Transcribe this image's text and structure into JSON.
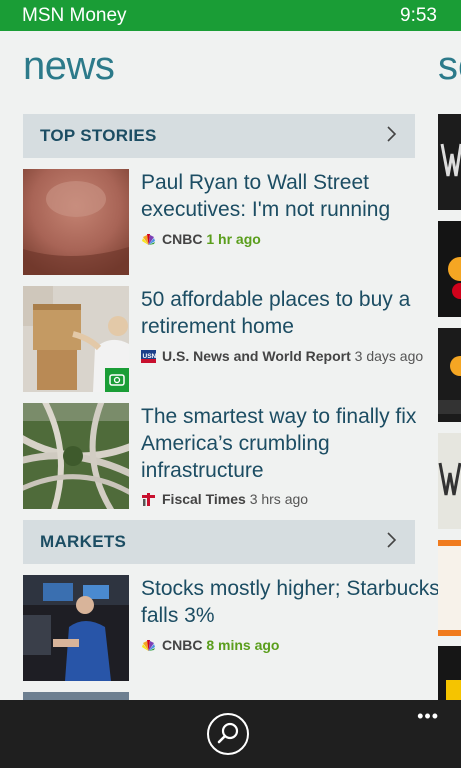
{
  "status": {
    "app_name": "MSN Money",
    "time": "9:53"
  },
  "page": {
    "title": "news",
    "next_title_peek": "so"
  },
  "sections": {
    "top_stories": "TOP STORIES",
    "markets": "MARKETS"
  },
  "stories": [
    {
      "headline": "Paul Ryan to Wall Street executives: I'm not running",
      "source": "CNBC",
      "time": "1 hr ago"
    },
    {
      "headline": "50 affordable places to buy a retirement home",
      "source": "U.S. News and World Report",
      "time": "3 days ago"
    },
    {
      "headline": "The smartest way to finally fix America’s crumbling infrastructure",
      "source": "Fiscal Times",
      "time": "3 hrs ago"
    },
    {
      "headline": "Stocks mostly higher; Starbucks falls 3%",
      "source": "CNBC",
      "time": "8 mins ago"
    }
  ],
  "appbar": {
    "more": "•••"
  },
  "colors": {
    "status_bar": "#1a9d36",
    "accent_text": "#1c4d63",
    "title": "#2c7a8a",
    "time_green": "#5a9e1c",
    "app_bar": "#1f1f1f"
  }
}
